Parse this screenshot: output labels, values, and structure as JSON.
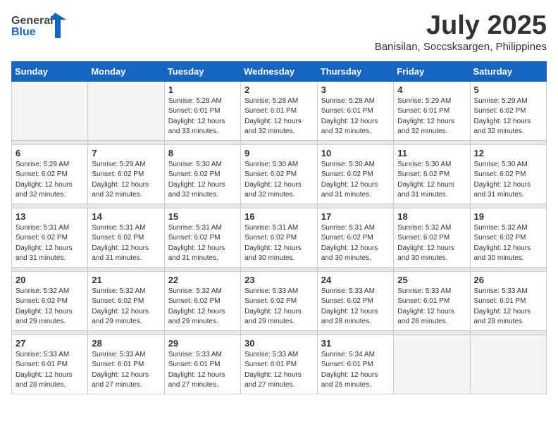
{
  "logo": {
    "text_general": "General",
    "text_blue": "Blue"
  },
  "title": "July 2025",
  "subtitle": "Banisilan, Soccsksargen, Philippines",
  "weekdays": [
    "Sunday",
    "Monday",
    "Tuesday",
    "Wednesday",
    "Thursday",
    "Friday",
    "Saturday"
  ],
  "weeks": [
    [
      {
        "day": "",
        "info": ""
      },
      {
        "day": "",
        "info": ""
      },
      {
        "day": "1",
        "info": "Sunrise: 5:28 AM\nSunset: 6:01 PM\nDaylight: 12 hours\nand 33 minutes."
      },
      {
        "day": "2",
        "info": "Sunrise: 5:28 AM\nSunset: 6:01 PM\nDaylight: 12 hours\nand 32 minutes."
      },
      {
        "day": "3",
        "info": "Sunrise: 5:28 AM\nSunset: 6:01 PM\nDaylight: 12 hours\nand 32 minutes."
      },
      {
        "day": "4",
        "info": "Sunrise: 5:29 AM\nSunset: 6:01 PM\nDaylight: 12 hours\nand 32 minutes."
      },
      {
        "day": "5",
        "info": "Sunrise: 5:29 AM\nSunset: 6:02 PM\nDaylight: 12 hours\nand 32 minutes."
      }
    ],
    [
      {
        "day": "6",
        "info": "Sunrise: 5:29 AM\nSunset: 6:02 PM\nDaylight: 12 hours\nand 32 minutes."
      },
      {
        "day": "7",
        "info": "Sunrise: 5:29 AM\nSunset: 6:02 PM\nDaylight: 12 hours\nand 32 minutes."
      },
      {
        "day": "8",
        "info": "Sunrise: 5:30 AM\nSunset: 6:02 PM\nDaylight: 12 hours\nand 32 minutes."
      },
      {
        "day": "9",
        "info": "Sunrise: 5:30 AM\nSunset: 6:02 PM\nDaylight: 12 hours\nand 32 minutes."
      },
      {
        "day": "10",
        "info": "Sunrise: 5:30 AM\nSunset: 6:02 PM\nDaylight: 12 hours\nand 31 minutes."
      },
      {
        "day": "11",
        "info": "Sunrise: 5:30 AM\nSunset: 6:02 PM\nDaylight: 12 hours\nand 31 minutes."
      },
      {
        "day": "12",
        "info": "Sunrise: 5:30 AM\nSunset: 6:02 PM\nDaylight: 12 hours\nand 31 minutes."
      }
    ],
    [
      {
        "day": "13",
        "info": "Sunrise: 5:31 AM\nSunset: 6:02 PM\nDaylight: 12 hours\nand 31 minutes."
      },
      {
        "day": "14",
        "info": "Sunrise: 5:31 AM\nSunset: 6:02 PM\nDaylight: 12 hours\nand 31 minutes."
      },
      {
        "day": "15",
        "info": "Sunrise: 5:31 AM\nSunset: 6:02 PM\nDaylight: 12 hours\nand 31 minutes."
      },
      {
        "day": "16",
        "info": "Sunrise: 5:31 AM\nSunset: 6:02 PM\nDaylight: 12 hours\nand 30 minutes."
      },
      {
        "day": "17",
        "info": "Sunrise: 5:31 AM\nSunset: 6:02 PM\nDaylight: 12 hours\nand 30 minutes."
      },
      {
        "day": "18",
        "info": "Sunrise: 5:32 AM\nSunset: 6:02 PM\nDaylight: 12 hours\nand 30 minutes."
      },
      {
        "day": "19",
        "info": "Sunrise: 5:32 AM\nSunset: 6:02 PM\nDaylight: 12 hours\nand 30 minutes."
      }
    ],
    [
      {
        "day": "20",
        "info": "Sunrise: 5:32 AM\nSunset: 6:02 PM\nDaylight: 12 hours\nand 29 minutes."
      },
      {
        "day": "21",
        "info": "Sunrise: 5:32 AM\nSunset: 6:02 PM\nDaylight: 12 hours\nand 29 minutes."
      },
      {
        "day": "22",
        "info": "Sunrise: 5:32 AM\nSunset: 6:02 PM\nDaylight: 12 hours\nand 29 minutes."
      },
      {
        "day": "23",
        "info": "Sunrise: 5:33 AM\nSunset: 6:02 PM\nDaylight: 12 hours\nand 29 minutes."
      },
      {
        "day": "24",
        "info": "Sunrise: 5:33 AM\nSunset: 6:02 PM\nDaylight: 12 hours\nand 28 minutes."
      },
      {
        "day": "25",
        "info": "Sunrise: 5:33 AM\nSunset: 6:01 PM\nDaylight: 12 hours\nand 28 minutes."
      },
      {
        "day": "26",
        "info": "Sunrise: 5:33 AM\nSunset: 6:01 PM\nDaylight: 12 hours\nand 28 minutes."
      }
    ],
    [
      {
        "day": "27",
        "info": "Sunrise: 5:33 AM\nSunset: 6:01 PM\nDaylight: 12 hours\nand 28 minutes."
      },
      {
        "day": "28",
        "info": "Sunrise: 5:33 AM\nSunset: 6:01 PM\nDaylight: 12 hours\nand 27 minutes."
      },
      {
        "day": "29",
        "info": "Sunrise: 5:33 AM\nSunset: 6:01 PM\nDaylight: 12 hours\nand 27 minutes."
      },
      {
        "day": "30",
        "info": "Sunrise: 5:33 AM\nSunset: 6:01 PM\nDaylight: 12 hours\nand 27 minutes."
      },
      {
        "day": "31",
        "info": "Sunrise: 5:34 AM\nSunset: 6:01 PM\nDaylight: 12 hours\nand 26 minutes."
      },
      {
        "day": "",
        "info": ""
      },
      {
        "day": "",
        "info": ""
      }
    ]
  ]
}
